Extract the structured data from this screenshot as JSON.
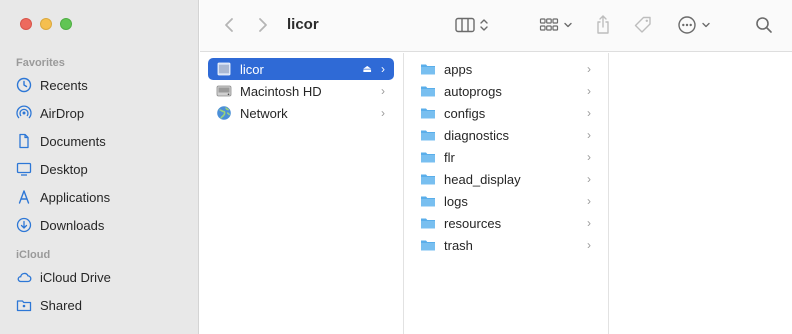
{
  "window": {
    "title": "licor"
  },
  "sidebar": {
    "favorites_title": "Favorites",
    "favorites": [
      {
        "label": "Recents",
        "icon": "clock-icon"
      },
      {
        "label": "AirDrop",
        "icon": "airdrop-icon"
      },
      {
        "label": "Documents",
        "icon": "document-icon"
      },
      {
        "label": "Desktop",
        "icon": "desktop-icon"
      },
      {
        "label": "Applications",
        "icon": "applications-icon"
      },
      {
        "label": "Downloads",
        "icon": "download-icon"
      }
    ],
    "icloud_title": "iCloud",
    "icloud": [
      {
        "label": "iCloud Drive",
        "icon": "cloud-icon"
      },
      {
        "label": "Shared",
        "icon": "shared-folder-icon"
      }
    ]
  },
  "columns": {
    "locations": [
      {
        "label": "licor",
        "icon": "external-drive-icon",
        "selected": true,
        "eject": "⏏"
      },
      {
        "label": "Macintosh HD",
        "icon": "hard-drive-icon",
        "selected": false
      },
      {
        "label": "Network",
        "icon": "network-globe-icon",
        "selected": false
      }
    ],
    "folders": [
      {
        "label": "apps"
      },
      {
        "label": "autoprogs"
      },
      {
        "label": "configs"
      },
      {
        "label": "diagnostics"
      },
      {
        "label": "flr"
      },
      {
        "label": "head_display"
      },
      {
        "label": "logs"
      },
      {
        "label": "resources"
      },
      {
        "label": "trash"
      }
    ]
  },
  "colors": {
    "accent": "#2f6ad6",
    "folder": "#5aaeea",
    "sidebar_icon": "#2d77d6"
  }
}
